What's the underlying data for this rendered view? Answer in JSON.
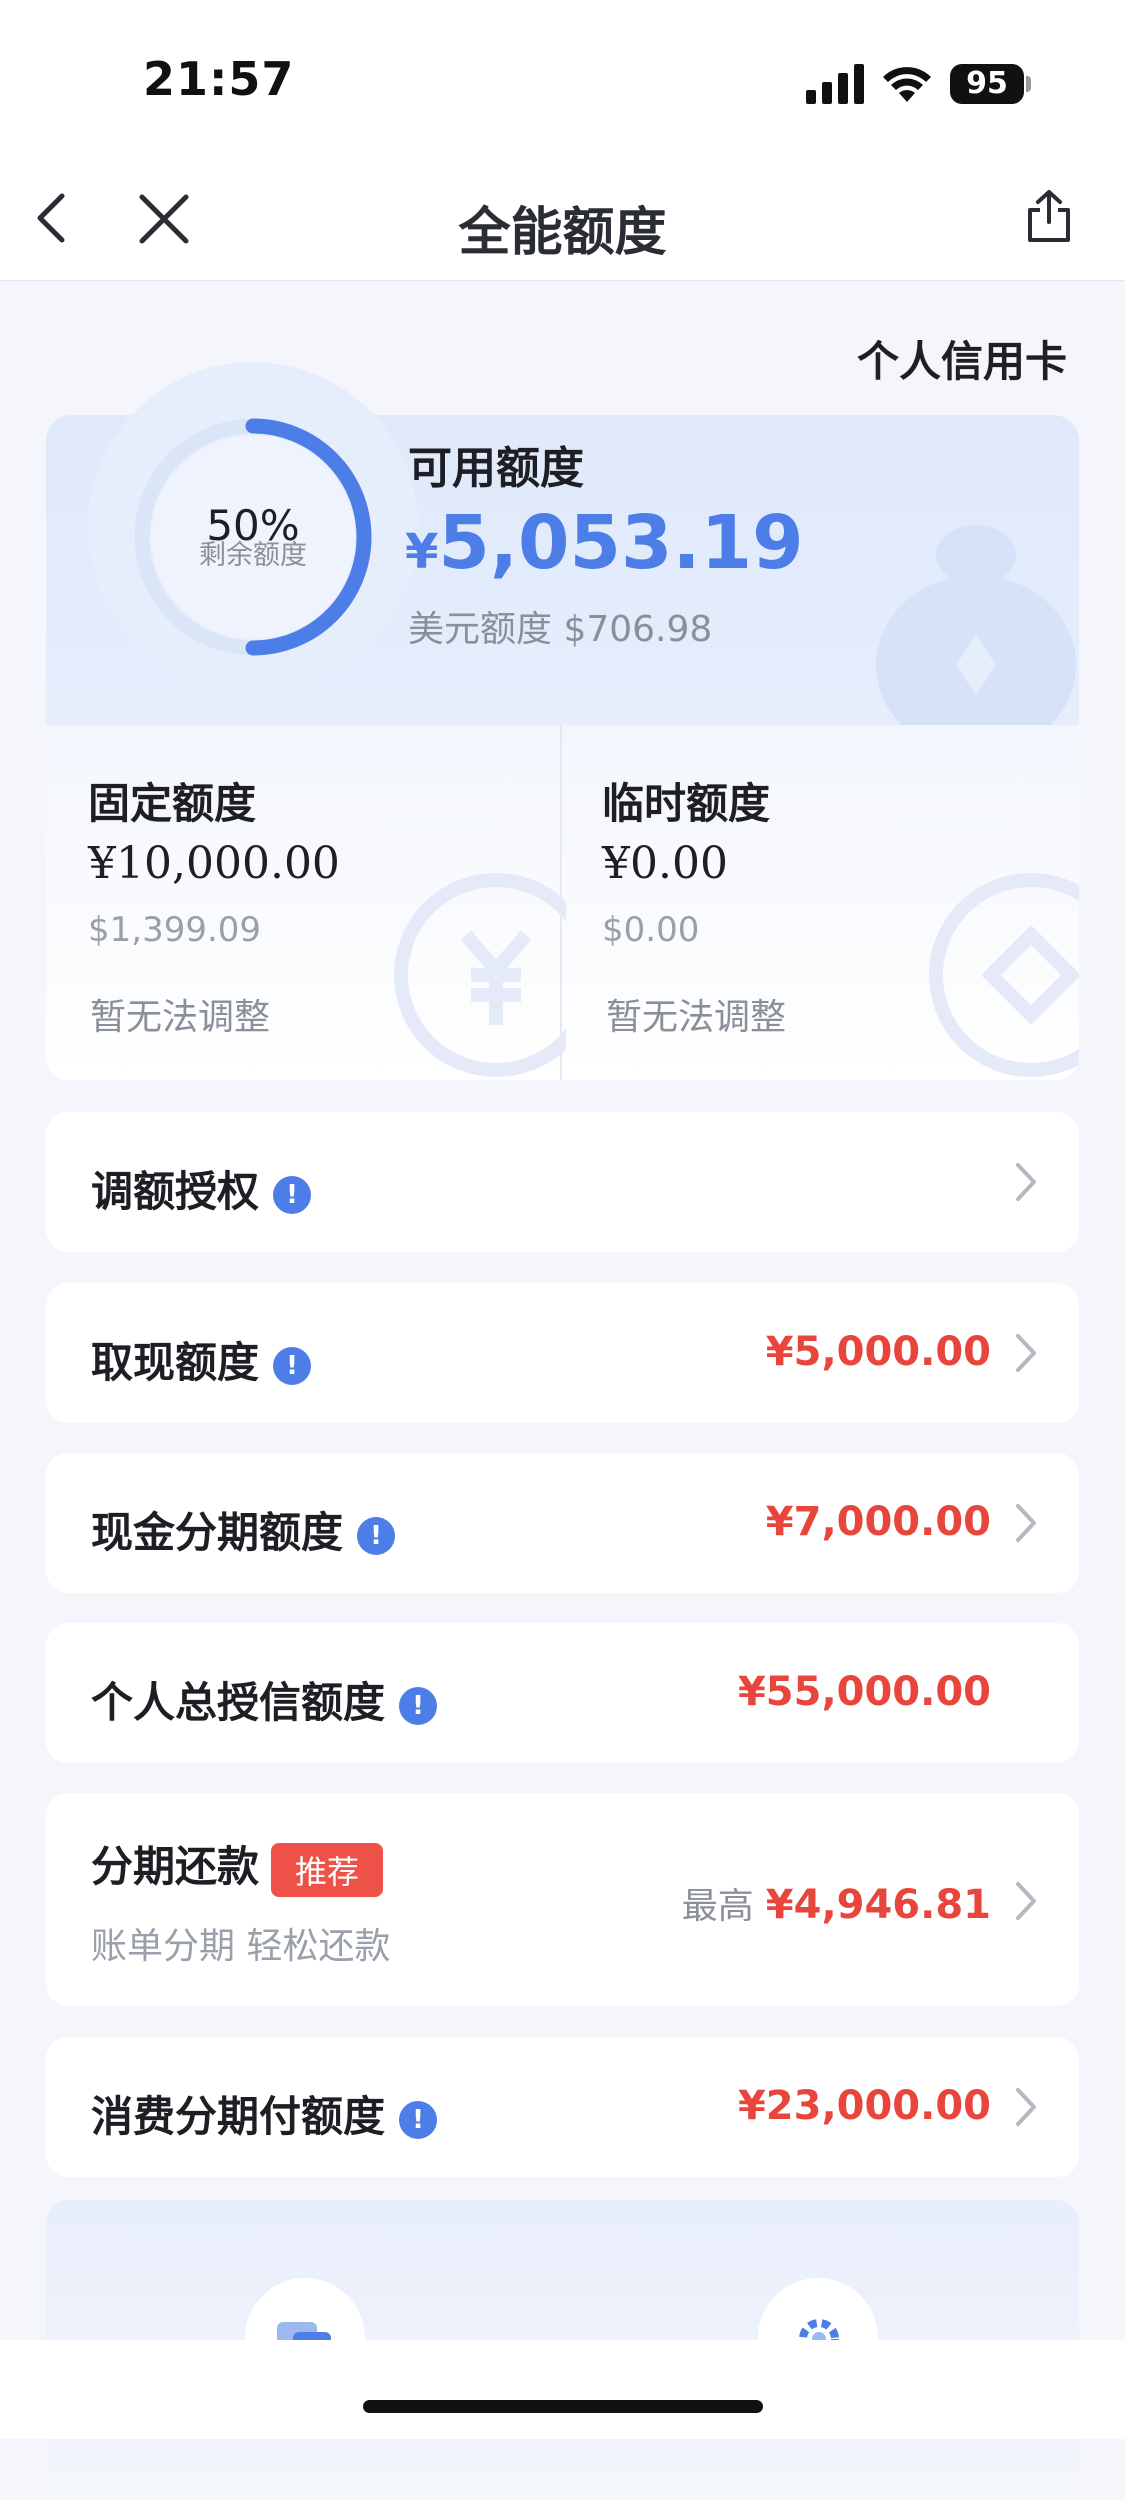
{
  "status_bar": {
    "time": "21:57",
    "battery": "95"
  },
  "nav": {
    "title": "全能额度"
  },
  "card_type": "个人信用卡",
  "hero": {
    "percent": "50%",
    "percent_caption": "剩余额度",
    "remaining_fraction": 0.5,
    "available_title": "可用额度",
    "currency_symbol": "¥",
    "available_amount": "5,053.19",
    "usd_line": "美元额度 $706.98"
  },
  "quotas": [
    {
      "title": "固定额度",
      "amount": "¥10,000.00",
      "usd": "$1,399.09",
      "note": "暂无法调整"
    },
    {
      "title": "临时额度",
      "amount": "¥0.00",
      "usd": "$0.00",
      "note": "暂无法调整"
    }
  ],
  "rows": {
    "adjust_auth": {
      "label": "调额授权"
    },
    "cash_withdraw": {
      "label": "取现额度",
      "value": "¥5,000.00"
    },
    "cash_installment": {
      "label": "现金分期额度",
      "value": "¥7,000.00"
    },
    "total_credit": {
      "label": "个人总授信额度",
      "value": "¥55,000.00"
    },
    "installment_repay": {
      "label": "分期还款",
      "tag": "推荐",
      "subtitle": "账单分期 轻松还款",
      "max_label": "最高",
      "value": "¥4,946.81"
    },
    "consumer_installment": {
      "label": "消费分期付额度",
      "value": "¥23,000.00"
    }
  },
  "colors": {
    "accent": "#4d7ee8",
    "value_red": "#e8453c",
    "tag_red": "#ee5147"
  }
}
